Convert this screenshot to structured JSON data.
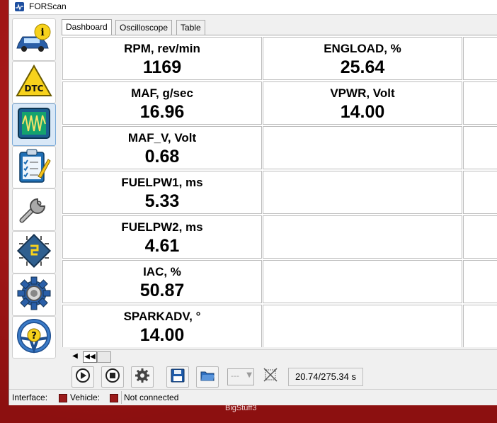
{
  "window": {
    "title": "FORScan"
  },
  "tabs": [
    {
      "label": "Dashboard",
      "active": true
    },
    {
      "label": "Oscilloscope",
      "active": false
    },
    {
      "label": "Table",
      "active": false
    }
  ],
  "sidebar": {
    "items": [
      {
        "name": "vehicle-info",
        "icon": "car-info-icon"
      },
      {
        "name": "dtc",
        "icon": "dtc-warning-icon"
      },
      {
        "name": "oscilloscope",
        "icon": "oscilloscope-icon",
        "active": true
      },
      {
        "name": "tests",
        "icon": "checklist-icon"
      },
      {
        "name": "service",
        "icon": "wrench-icon"
      },
      {
        "name": "configuration",
        "icon": "chip-icon"
      },
      {
        "name": "settings",
        "icon": "gear-icon"
      },
      {
        "name": "help",
        "icon": "help-steering-icon"
      }
    ]
  },
  "dashboard": {
    "cells": [
      {
        "label": "RPM, rev/min",
        "value": "1169"
      },
      {
        "label": "ENGLOAD, %",
        "value": "25.64"
      },
      {
        "label": "MAF, g/sec",
        "value": "16.96"
      },
      {
        "label": "VPWR, Volt",
        "value": "14.00"
      },
      {
        "label": "MAF_V, Volt",
        "value": "0.68"
      },
      {
        "label": "FUELPW1, ms",
        "value": "5.33"
      },
      {
        "label": "FUELPW2, ms",
        "value": "4.61"
      },
      {
        "label": "IAC, %",
        "value": "50.87"
      },
      {
        "label": "SPARKADV, °",
        "value": "14.00"
      }
    ]
  },
  "toolbar": {
    "time": "20.74/275.34 s",
    "combo_value": "---"
  },
  "statusbar": {
    "interface_label": "Interface:",
    "vehicle_label": "Vehicle:",
    "connection_status": "Not connected",
    "indicator_color": "#9b1b1b"
  },
  "desktop": {
    "label": "BigStuff3"
  }
}
